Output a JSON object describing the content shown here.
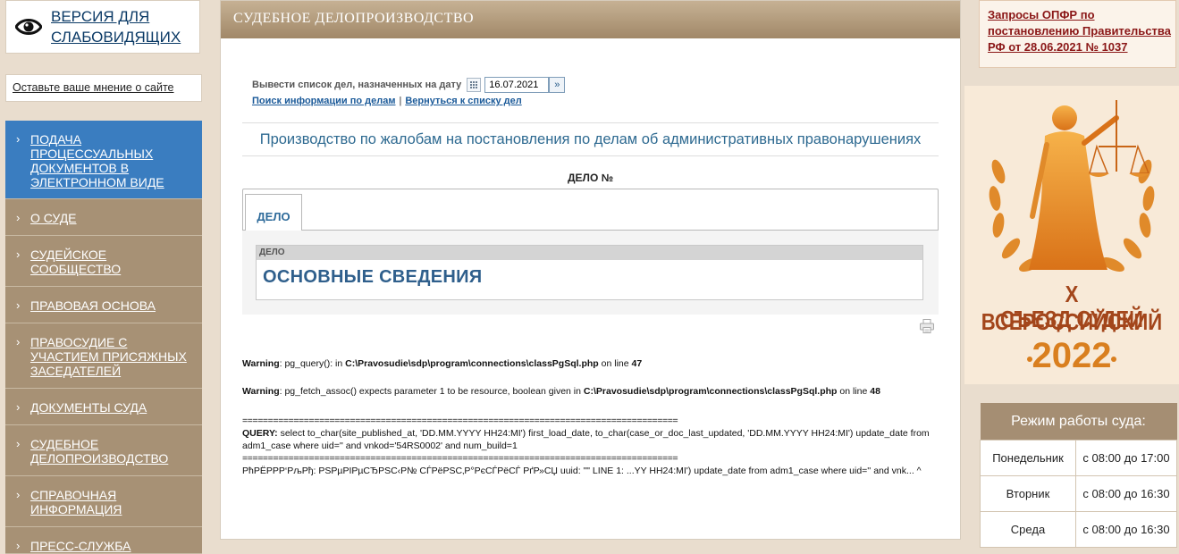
{
  "accessibility": {
    "label": "ВЕРСИЯ ДЛЯ СЛАБОВИДЯЩИХ",
    "icon": "eye-icon"
  },
  "feedback": {
    "label": "Оставьте ваше мнение о сайте"
  },
  "nav": {
    "items": [
      {
        "label": "ПОДАЧА ПРОЦЕССУАЛЬНЫХ ДОКУМЕНТОВ В ЭЛЕКТРОННОМ ВИДЕ",
        "active": true
      },
      {
        "label": "О СУДЕ",
        "active": false
      },
      {
        "label": "СУДЕЙСКОЕ СООБЩЕСТВО",
        "active": false
      },
      {
        "label": "ПРАВОВАЯ ОСНОВА",
        "active": false
      },
      {
        "label": "ПРАВОСУДИЕ С УЧАСТИЕМ ПРИСЯЖНЫХ ЗАСЕДАТЕЛЕЙ",
        "active": false
      },
      {
        "label": "ДОКУМЕНТЫ СУДА",
        "active": false
      },
      {
        "label": "СУДЕБНОЕ ДЕЛОПРОИЗВОДСТВО",
        "active": false
      },
      {
        "label": "СПРАВОЧНАЯ ИНФОРМАЦИЯ",
        "active": false
      },
      {
        "label": "ПРЕСС-СЛУЖБА",
        "active": false
      }
    ],
    "arrow": "›"
  },
  "main": {
    "header": "СУДЕБНОЕ ДЕЛОПРОИЗВОДСТВО",
    "date_label": "Вывести список дел, назначенных на дату",
    "date_value": "16.07.2021",
    "link_search": "Поиск информации по делам",
    "link_separator": "|",
    "link_back": "Вернуться к списку дел",
    "proceeding_title": "Производство по жалобам на постановления по делам об административных правонарушениях",
    "case_number_label": "ДЕЛО №",
    "tab_label": "ДЕЛО",
    "section_label": "ДЕЛО",
    "section_title": "ОСНОВНЫЕ СВЕДЕНИЯ"
  },
  "errors": {
    "warning_label": "Warning",
    "w1_msg": ": pg_query(): in ",
    "w1_path": "C:\\Pravosudie\\sdp\\program\\connections\\classPgSql.php",
    "w1_line_text": " on line ",
    "w1_line": "47",
    "w2_msg": ": pg_fetch_assoc() expects parameter 1 to be resource, boolean given in ",
    "w2_path": "C:\\Pravosudie\\sdp\\program\\connections\\classPgSql.php",
    "w2_line_text": " on line ",
    "w2_line": "48",
    "rule": "=====================================================================================",
    "query_label": "QUERY:",
    "query_text": " select to_char(site_published_at, 'DD.MM.YYYY HH24:MI') first_load_date, to_char(case_or_doc_last_updated, 'DD.MM.YYYY HH24:MI') update_date from adm1_case where uid='' and vnkod='54RS0002' and num_build=1",
    "error_text": "РћРЁРРР‘РљРђ: РЅРµРІРµСЂРЅС‹Р№ СЃРёРЅС‚Р°РєСЃРёСЃ РґР»СЏ uuid: \"\" LINE 1: ...YY HH24:MI') update_date from adm1_case where uid='' and vnk... ^"
  },
  "notice": {
    "label": "Запросы ОПФР по постановлению Правительства РФ от 28.06.2021 № 1037"
  },
  "congress": {
    "line1": "X ВСЕРОССИЙСКИЙ",
    "line2": "СЪЕЗД СУДЕЙ",
    "year": "2022"
  },
  "hours": {
    "title": "Режим работы суда:",
    "rows": [
      {
        "day": "Понедельник",
        "time": "с 08:00 до 17:00"
      },
      {
        "day": "Вторник",
        "time": "с 08:00 до 16:30"
      },
      {
        "day": "Среда",
        "time": "с 08:00 до 16:30"
      }
    ]
  },
  "colors": {
    "nav_bg": "#a79175",
    "nav_active": "#3a7dc0",
    "header_brown": "#a18868",
    "notice_red": "#8a1616",
    "congress_orange": "#d97f1f"
  }
}
